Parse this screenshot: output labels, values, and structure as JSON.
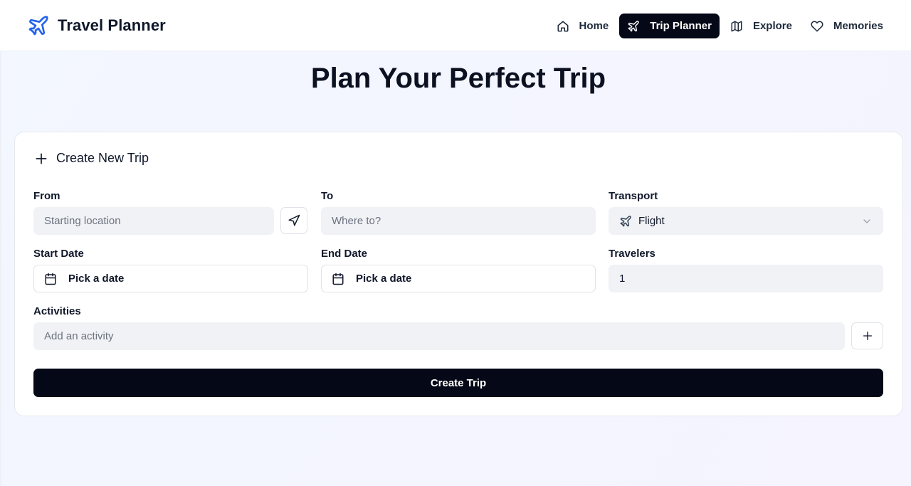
{
  "app": {
    "title": "Travel Planner",
    "accent": "#2563eb",
    "dark": "#050816"
  },
  "nav": {
    "items": [
      {
        "label": "Home",
        "icon": "home-icon",
        "active": false
      },
      {
        "label": "Trip Planner",
        "icon": "plane-icon",
        "active": true
      },
      {
        "label": "Explore",
        "icon": "map-icon",
        "active": false
      },
      {
        "label": "Memories",
        "icon": "heart-icon",
        "active": false
      }
    ]
  },
  "page": {
    "title": "Plan Your Perfect Trip"
  },
  "form": {
    "heading": "Create New Trip",
    "from": {
      "label": "From",
      "placeholder": "Starting location"
    },
    "to": {
      "label": "To",
      "placeholder": "Where to?"
    },
    "transport": {
      "label": "Transport",
      "value": "Flight"
    },
    "start_date": {
      "label": "Start Date",
      "value": "Pick a date"
    },
    "end_date": {
      "label": "End Date",
      "value": "Pick a date"
    },
    "travelers": {
      "label": "Travelers",
      "value": "1"
    },
    "activities": {
      "label": "Activities",
      "placeholder": "Add an activity"
    },
    "submit_label": "Create Trip"
  }
}
